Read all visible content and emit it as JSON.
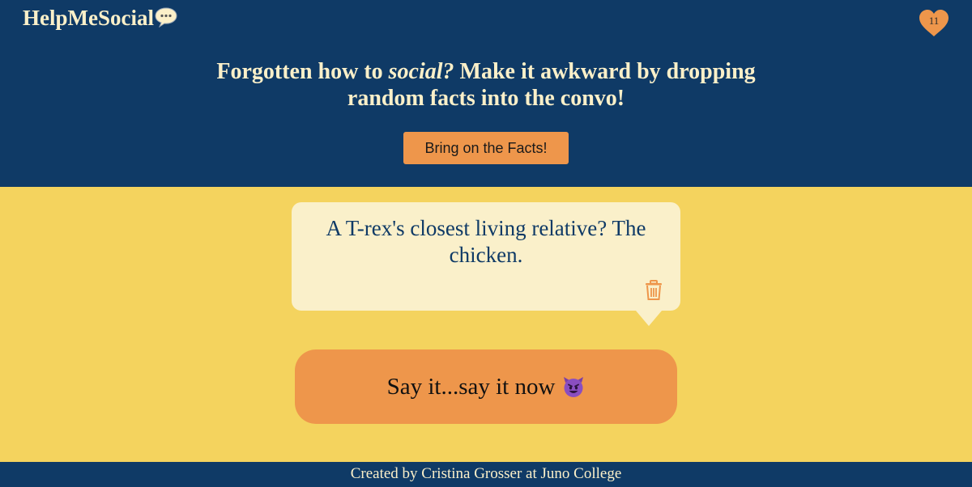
{
  "header": {
    "logo_text": "HelpMeSocial",
    "logo_icon": "speech-bubble-icon",
    "favorites_count": "11",
    "favorites_icon": "heart-icon",
    "tagline_part1": "Forgotten how to ",
    "tagline_emphasis": "social?",
    "tagline_part2": " Make it awkward by dropping random facts into the convo!",
    "facts_button": "Bring on the Facts!"
  },
  "fact": {
    "text": "A T-rex's closest living relative? The chicken.",
    "delete_icon": "trash-icon"
  },
  "say_button": {
    "label": "Say it...say it now",
    "emoji": "smiling-devil-icon"
  },
  "footer": {
    "text": "Created by Cristina Grosser at Juno College"
  },
  "colors": {
    "navy": "#0f3a66",
    "cream": "#faf0ca",
    "yellow": "#f4d35e",
    "orange": "#ee964b"
  }
}
